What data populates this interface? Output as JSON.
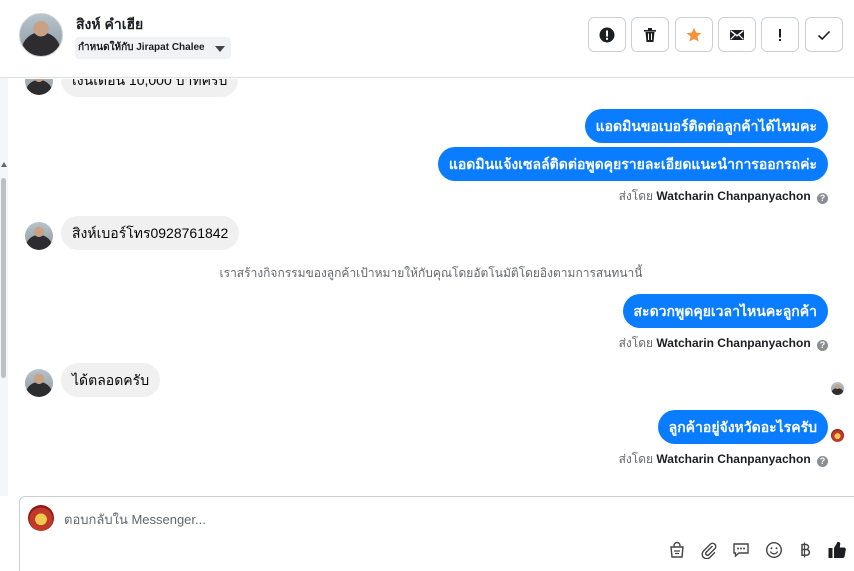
{
  "header": {
    "contact_name": "สิงห์ คำเฮีย",
    "assign_label": "กำหนดให้กับ Jirapat Chalee",
    "buttons": [
      {
        "name": "spam-button",
        "icon": "alert-circle-icon"
      },
      {
        "name": "delete-button",
        "icon": "trash-icon"
      },
      {
        "name": "star-button",
        "icon": "star-icon",
        "color": "#f7923b"
      },
      {
        "name": "mark-unread-button",
        "icon": "envelope-icon"
      },
      {
        "name": "follow-up-button",
        "icon": "exclamation-icon"
      },
      {
        "name": "mark-done-button",
        "icon": "check-icon"
      }
    ]
  },
  "messages": {
    "m0": "เงินเดือน 10,000 บาทครับ",
    "m1": "แอดมินขอเบอร์ติดต่อลูกค้าได้ไหมคะ",
    "m2": "แอดมินแจ้งเซลล์ติดต่อพูดคุยรายละเอียดแนะนำการออกรถค่ะ",
    "m3": "สิงห์เบอร์โทร0928761842",
    "system_note": "เราสร้างกิจกรรมของลูกค้าเป้าหมายให้กับคุณโดยอัตโนมัติโดยอิงตามการสนทนานี้",
    "m4": "สะดวกพูดคุยเวลาไหนคะลูกค้า",
    "m5": "ได้ตลอดครับ",
    "m6": "ลูกค้าอยู่จังหวัดอะไรครับ"
  },
  "sent_by": {
    "prefix": "ส่งโดย",
    "agent": "Watcharin Chanpanyachon",
    "info_glyph": "?"
  },
  "composer": {
    "placeholder": "ตอบกลับใน Messenger...",
    "tools": [
      "shopping-bag-icon",
      "paperclip-icon",
      "saved-replies-icon",
      "emoji-icon",
      "baht-icon",
      "thumbs-up-icon"
    ]
  },
  "colors": {
    "outgoing_bubble": "#0a7cff",
    "incoming_bubble": "#f0f0f0",
    "star": "#f7923b"
  }
}
